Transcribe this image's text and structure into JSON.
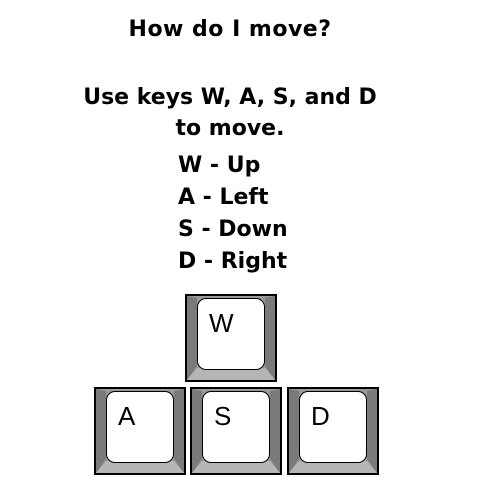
{
  "title": "How do I move?",
  "instructions": {
    "line1": "Use keys W, A, S, and D",
    "line2": "to move."
  },
  "mappings": [
    "W - Up",
    "A - Left",
    "S - Down",
    "D - Right"
  ],
  "keys": {
    "w": "W",
    "a": "A",
    "s": "S",
    "d": "D"
  },
  "colors": {
    "key_body": "#9a9a9a",
    "key_face": "#ffffff",
    "text": "#000000"
  }
}
